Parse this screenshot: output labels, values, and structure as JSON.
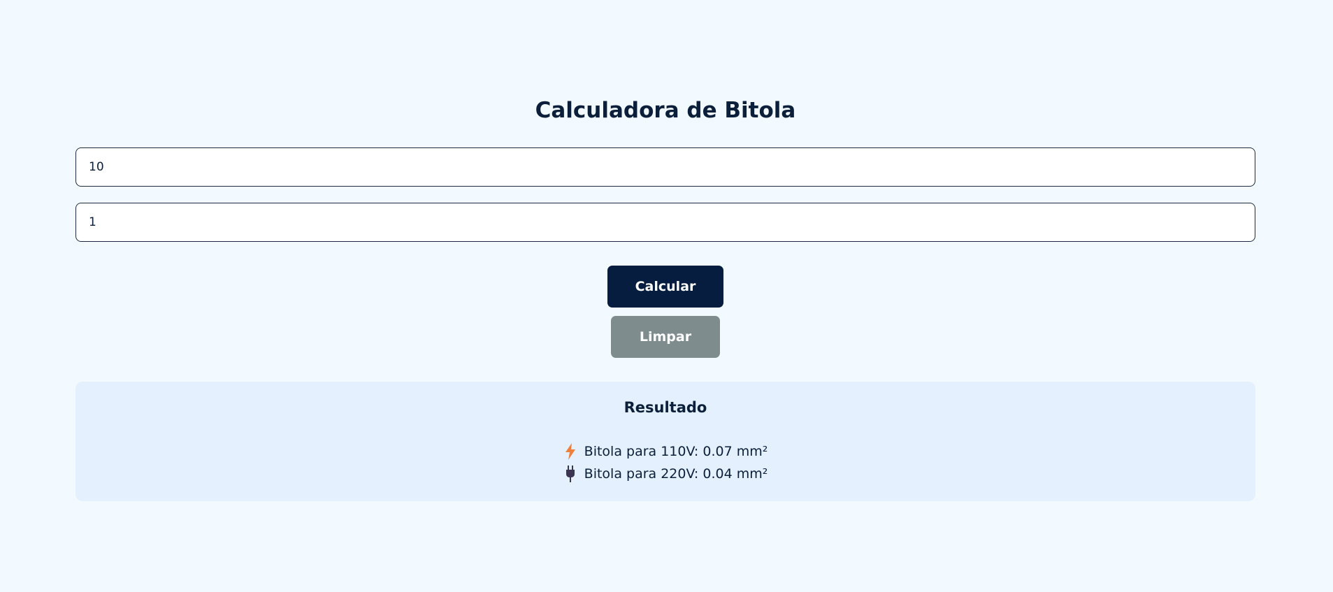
{
  "page": {
    "title": "Calculadora de Bitola"
  },
  "form": {
    "field_1_value": "10",
    "field_2_value": "1",
    "calculate_label": "Calcular",
    "clear_label": "Limpar"
  },
  "result": {
    "title": "Resultado",
    "items": [
      {
        "icon": "lightning-icon",
        "text": "Bitola para 110V: 0.07 mm²"
      },
      {
        "icon": "plug-icon",
        "text": "Bitola para 220V: 0.04 mm²"
      }
    ]
  },
  "colors": {
    "background": "#f2faff",
    "primary_button": "#061d3f",
    "secondary_button": "#7f8c8d",
    "result_background": "#e4f0fd",
    "text": "#0b1f3a",
    "lightning": "#f07f3c"
  }
}
